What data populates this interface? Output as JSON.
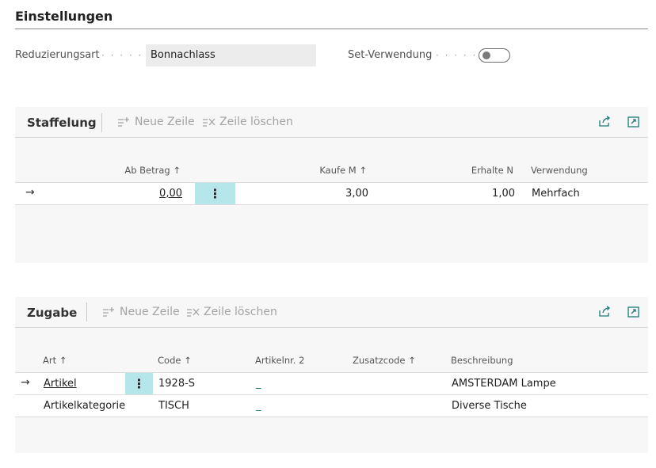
{
  "settings": {
    "title": "Einstellungen",
    "reduction_label": "Reduzierungsart",
    "reduction_value": "Bonnachlass",
    "set_label": "Set-Verwendung",
    "set_on": false,
    "dots": "· · · · · ·"
  },
  "staffelung": {
    "title": "Staffelung",
    "new_row": "Neue Zeile",
    "delete_row": "Zeile löschen",
    "columns": {
      "ab_betrag": "Ab Betrag ↑",
      "kaufe": "Kaufe M ↑",
      "erhalte": "Erhalte N",
      "verwendung": "Verwendung"
    },
    "rows": [
      {
        "ab_betrag": "0,00",
        "kaufe": "3,00",
        "erhalte": "1,00",
        "verwendung": "Mehrfach"
      }
    ]
  },
  "zugabe": {
    "title": "Zugabe",
    "new_row": "Neue Zeile",
    "delete_row": "Zeile löschen",
    "columns": {
      "art": "Art ↑",
      "code": "Code ↑",
      "artikelnr2": "Artikelnr. 2",
      "zusatzcode": "Zusatzcode ↑",
      "beschreibung": "Beschreibung"
    },
    "rows": [
      {
        "art": "Artikel",
        "code": "1928-S",
        "artikelnr2": "_",
        "beschreibung": "AMSTERDAM Lampe"
      },
      {
        "art": "Artikelkategorie",
        "code": "TISCH",
        "artikelnr2": "_",
        "beschreibung": "Diverse Tische"
      }
    ]
  },
  "glyphs": {
    "row_arrow": "→",
    "menu_dots": "⋮"
  },
  "colors": {
    "accent": "#1c7a78",
    "selected_cell": "#b4e6ea"
  }
}
